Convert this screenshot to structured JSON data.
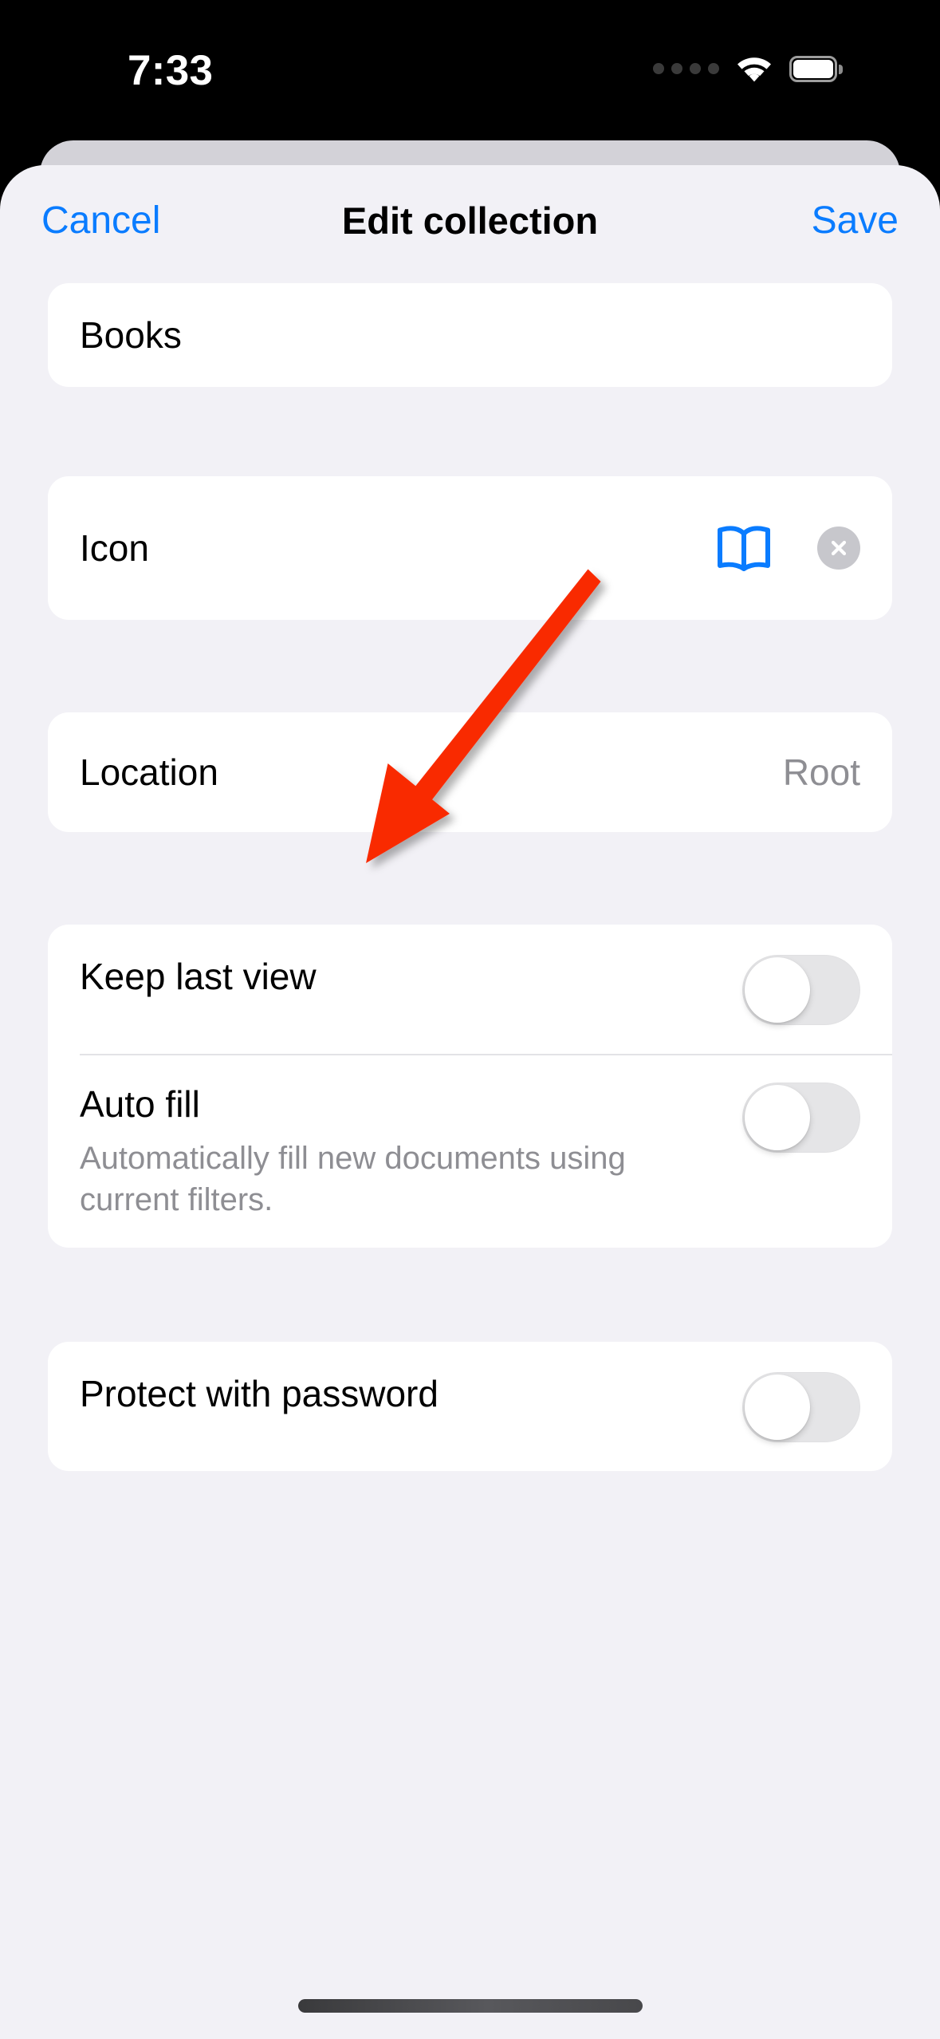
{
  "status_bar": {
    "time": "7:33",
    "icons": [
      "signal-dots-icon",
      "wifi-icon",
      "battery-icon"
    ],
    "battery_level": 100
  },
  "navbar": {
    "cancel_label": "Cancel",
    "title": "Edit collection",
    "save_label": "Save"
  },
  "form": {
    "name_field": {
      "value": "Books",
      "placeholder": "Name"
    },
    "icon_row": {
      "label": "Icon",
      "icon_name": "book-icon",
      "clear_label": "×"
    },
    "location_row": {
      "label": "Location",
      "value": "Root"
    },
    "options": [
      {
        "label": "Keep last view",
        "description": "",
        "enabled": false
      },
      {
        "label": "Auto fill",
        "description": "Automatically fill new documents using current filters.",
        "enabled": false
      }
    ],
    "password_row": {
      "label": "Protect with password",
      "enabled": false
    }
  },
  "annotation": {
    "type": "arrow",
    "color": "#f92b00",
    "points_to": "Location"
  },
  "colors": {
    "accent": "#0a7cff",
    "sheet_background": "#f2f1f6",
    "card_background": "#ffffff",
    "secondary_text": "#8e8e93",
    "toggle_off": "#e5e5e7",
    "annotation_red": "#f92b00"
  }
}
